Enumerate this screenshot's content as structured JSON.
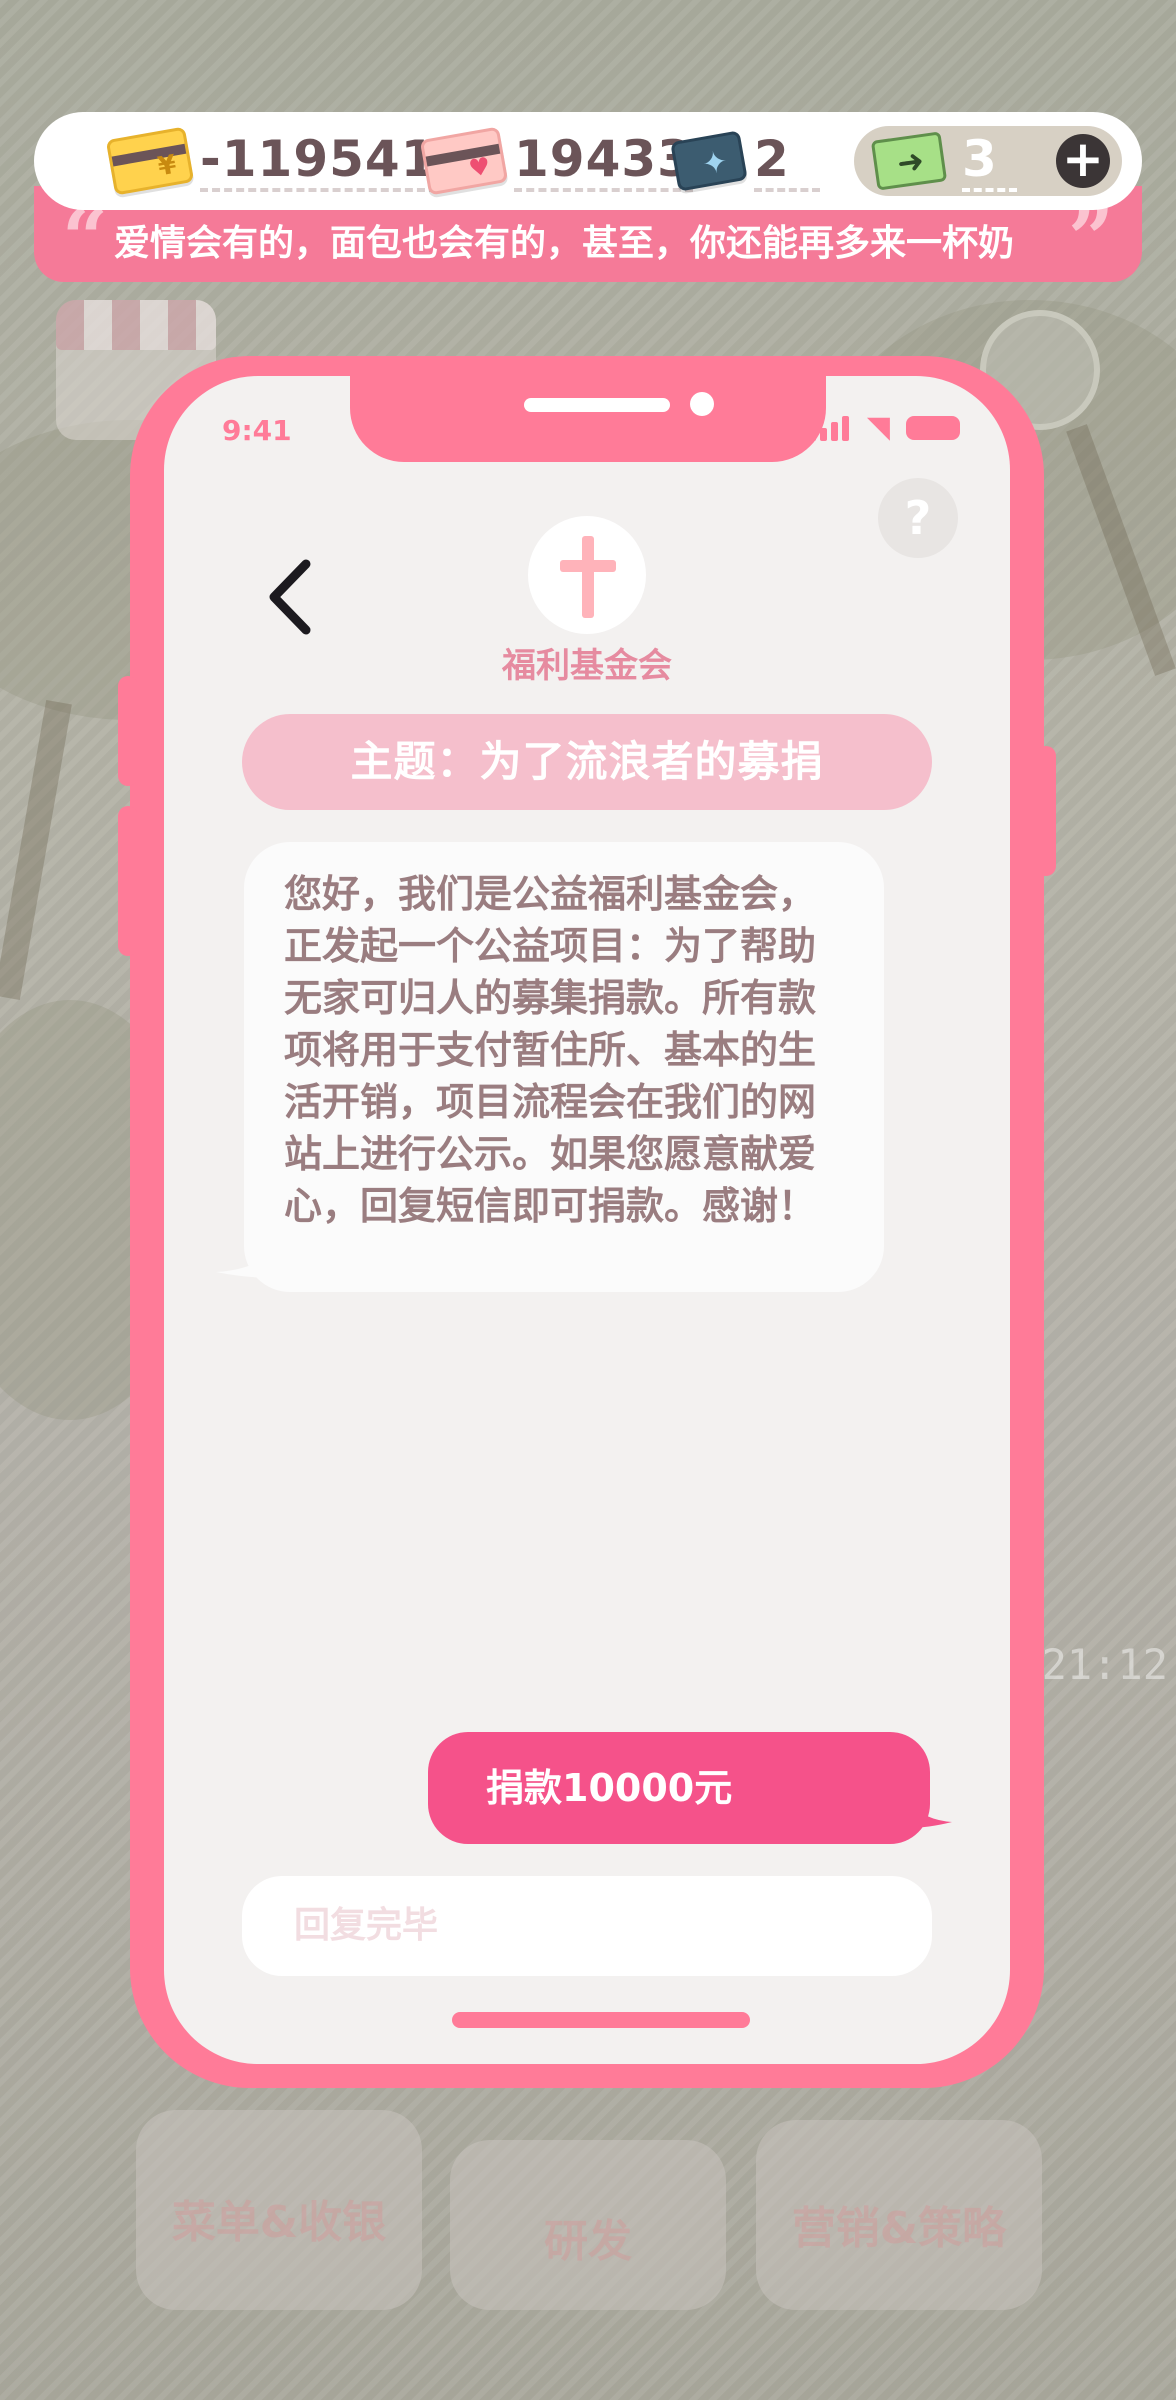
{
  "resources": {
    "money": {
      "icon": "money-card-icon",
      "value": "-119541"
    },
    "love": {
      "icon": "heart-card-icon",
      "value": "19433"
    },
    "star": {
      "icon": "star-card-icon",
      "value": "2"
    },
    "ticket": {
      "icon": "ticket-icon",
      "value": "3"
    }
  },
  "marquee": {
    "text": "爱情会有的，面包也会有的，甚至，你还能再多来一杯奶"
  },
  "phone": {
    "status_time": "9:41",
    "sender_name": "福利基金会",
    "subject": "主题：为了流浪者的募捐",
    "message": "您好，我们是公益福利基金会，正发起一个公益项目：为了帮助无家可归人的募集捐款。所有款项将用于支付暂住所、基本的生活开销，项目流程会在我们的网站上进行公示。如果您愿意献爱心，回复短信即可捐款。感谢！",
    "reply_option": "捐款10000元",
    "reply_input_placeholder": "回复完毕",
    "help_label": "?"
  },
  "background": {
    "clock": "21:12",
    "tiles": [
      "菜单&收银",
      "研发",
      "营销&策略"
    ]
  },
  "colors": {
    "phone_frame": "#ff7b98",
    "screen_bg": "#f3f1f0",
    "subject_bg": "#f5bfcc",
    "reply_bg": "#f5528a",
    "message_text": "#9a7d80",
    "sender_name": "#e68ba0"
  }
}
